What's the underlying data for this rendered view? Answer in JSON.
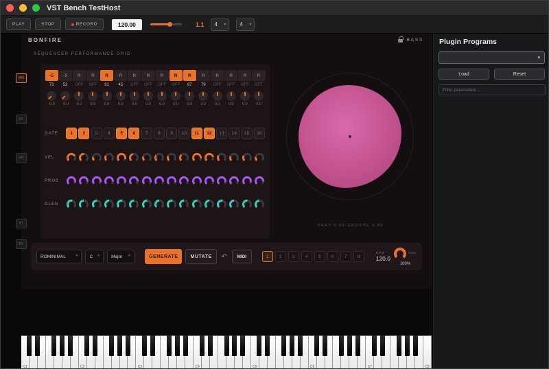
{
  "window": {
    "title": "VST Bench TestHost"
  },
  "toolbar": {
    "play": "PLAY",
    "stop": "STOP",
    "record": "RECORD",
    "tempo": "120.00",
    "position": "1.1",
    "timesig_numerator": "4",
    "timesig_denominator": "4"
  },
  "icons": {
    "chevron_down": "▾",
    "chevron_up": "^",
    "undo": "↶"
  },
  "colors": {
    "accent": "#e8722a",
    "purple": "#a855f7",
    "cyan": "#2dd4bf",
    "pink": "#c85a9e"
  },
  "plugin": {
    "name": "BONFIRE",
    "preset": "BASS",
    "section_title": "SEQUENCER PERFORMANCE GRID",
    "side_tabs": [
      "MN",
      "SY",
      "GR",
      "PT",
      "FX"
    ],
    "grid": {
      "labels": {
        "gate": "GATE",
        "vel": "VEL",
        "prob": "PROB",
        "glen": "GLEN"
      },
      "steps": [
        {
          "pitch": "-5",
          "pitch_on": true,
          "pitch_val": -5,
          "fine": "-5.0",
          "gate": true,
          "vel": "73",
          "vel_knob": 0.73,
          "prob": 0.9,
          "glen": 0.55
        },
        {
          "pitch": "-5",
          "pitch_on": false,
          "pitch_val": -5,
          "fine": "-5.0",
          "gate": true,
          "vel": "52",
          "vel_knob": 0.52,
          "prob": 0.85,
          "glen": 0.5
        },
        {
          "pitch": "R",
          "pitch_on": false,
          "pitch_val": 0,
          "fine": "0.0",
          "gate": false,
          "vel": "OFF",
          "vel_knob": 0.2,
          "prob": 0.9,
          "glen": 0.52
        },
        {
          "pitch": "R",
          "pitch_on": false,
          "pitch_val": 0,
          "fine": "0.0",
          "gate": false,
          "vel": "OFF",
          "vel_knob": 0.28,
          "prob": 0.86,
          "glen": 0.5
        },
        {
          "pitch": "R",
          "pitch_on": true,
          "pitch_val": 0,
          "fine": "0.0",
          "gate": true,
          "vel": "91",
          "vel_knob": 0.91,
          "prob": 0.92,
          "glen": 0.55
        },
        {
          "pitch": "R",
          "pitch_on": false,
          "pitch_val": 0,
          "fine": "0.0",
          "gate": true,
          "vel": "45",
          "vel_knob": 0.45,
          "prob": 0.85,
          "glen": 0.5
        },
        {
          "pitch": "R",
          "pitch_on": false,
          "pitch_val": 0,
          "fine": "0.0",
          "gate": false,
          "vel": "OFF",
          "vel_knob": 0.22,
          "prob": 0.9,
          "glen": 0.52
        },
        {
          "pitch": "R",
          "pitch_on": false,
          "pitch_val": 0,
          "fine": "0.0",
          "gate": false,
          "vel": "OFF",
          "vel_knob": 0.3,
          "prob": 0.87,
          "glen": 0.5
        },
        {
          "pitch": "R",
          "pitch_on": false,
          "pitch_val": 0,
          "fine": "0.0",
          "gate": false,
          "vel": "OFF",
          "vel_knob": 0.26,
          "prob": 0.9,
          "glen": 0.55
        },
        {
          "pitch": "R",
          "pitch_on": true,
          "pitch_val": 0,
          "fine": "0.0",
          "gate": false,
          "vel": "OFF",
          "vel_knob": 0.34,
          "prob": 0.85,
          "glen": 0.5
        },
        {
          "pitch": "R",
          "pitch_on": true,
          "pitch_val": 0,
          "fine": "0.0",
          "gate": true,
          "vel": "87",
          "vel_knob": 0.87,
          "prob": 0.92,
          "glen": 0.52
        },
        {
          "pitch": "R",
          "pitch_on": false,
          "pitch_val": 0,
          "fine": "0.0",
          "gate": true,
          "vel": "79",
          "vel_knob": 0.79,
          "prob": 0.87,
          "glen": 0.5
        },
        {
          "pitch": "R",
          "pitch_on": false,
          "pitch_val": 0,
          "fine": "0.0",
          "gate": false,
          "vel": "OFF",
          "vel_knob": 0.3,
          "prob": 0.9,
          "glen": 0.55
        },
        {
          "pitch": "R",
          "pitch_on": false,
          "pitch_val": 0,
          "fine": "0.0",
          "gate": false,
          "vel": "OFF",
          "vel_knob": 0.24,
          "prob": 0.85,
          "glen": 0.5
        },
        {
          "pitch": "R",
          "pitch_on": false,
          "pitch_val": 0,
          "fine": "0.0",
          "gate": false,
          "vel": "OFF",
          "vel_knob": 0.28,
          "prob": 0.9,
          "glen": 0.52
        },
        {
          "pitch": "R",
          "pitch_on": false,
          "pitch_val": 0,
          "fine": "0.0",
          "gate": false,
          "vel": "OFF",
          "vel_knob": 0.22,
          "prob": 0.86,
          "glen": 0.5
        }
      ]
    },
    "viz": {
      "caption": "VARY 0.50 GROOVE 0.50"
    },
    "bottom": {
      "style": "ROMINIMAL",
      "key": "C",
      "scale": "Major",
      "generate": "GENERATE",
      "mutate": "MUTATE",
      "midi": "MIDI",
      "patterns": [
        "1",
        "2",
        "3",
        "4",
        "5",
        "6",
        "7",
        "8"
      ],
      "active_pattern": 0,
      "bpm_label": "BPM",
      "bpm": "120.0",
      "vol_label": "VOL",
      "vol_value": "100%"
    }
  },
  "host_panel": {
    "title": "Plugin Programs",
    "load_button": "Load",
    "reset_button": "Reset",
    "filter_placeholder": "Filter parameters..."
  },
  "keyboard": {
    "white_keys": 50,
    "octave_labels": [
      "C1",
      "C2",
      "C3",
      "C4",
      "C5",
      "C6",
      "C7",
      "C8"
    ]
  }
}
